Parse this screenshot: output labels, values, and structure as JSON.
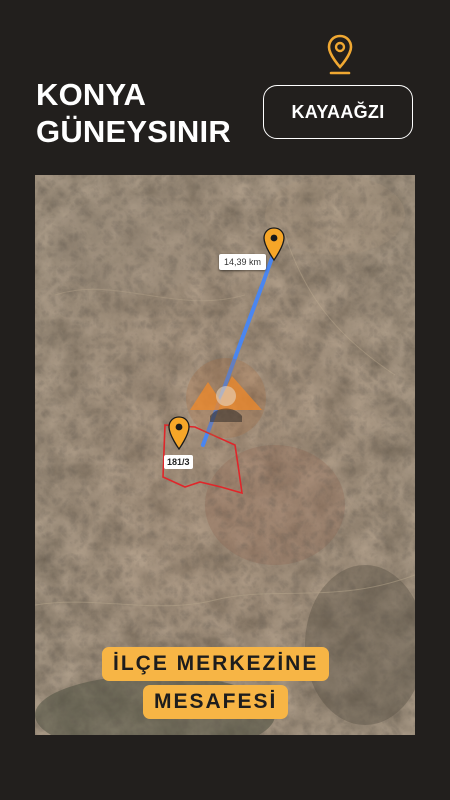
{
  "header": {
    "title_line1": "KONYA",
    "title_line2": "GÜNEYSINIR",
    "location_button": "KAYAAĞZI"
  },
  "icons": {
    "header_pin": "location-pin-icon",
    "map_pins": "location-pin-icon"
  },
  "map": {
    "distance_label": "14,39 km",
    "parcel_label": "181/3"
  },
  "banner": {
    "line1": "İLÇE MERKEZİNE",
    "line2": "MESAFESİ"
  },
  "colors": {
    "background": "#221f1d",
    "accent": "#f7b545",
    "route": "#4a86f0",
    "parcel_border": "#e0262a"
  }
}
